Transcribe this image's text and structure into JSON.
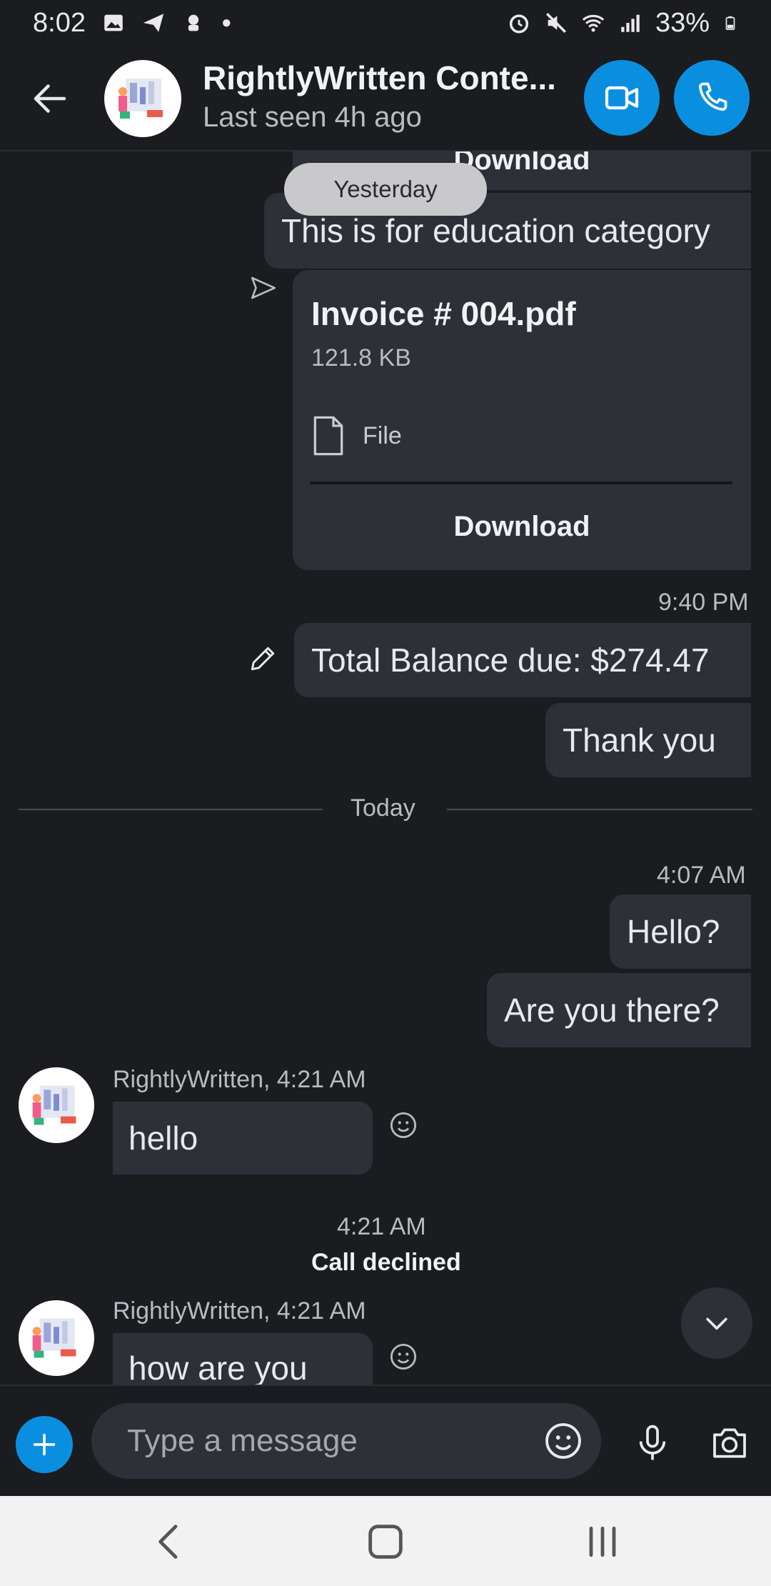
{
  "status_bar": {
    "time": "8:02",
    "battery": "33%"
  },
  "header": {
    "back_icon": "arrow-left-icon",
    "contact_name": "RightlyWritten Conte...",
    "last_seen": "Last seen 4h ago",
    "video_icon": "video-camera-icon",
    "phone_icon": "phone-icon",
    "accent": "#0a8fe0"
  },
  "chat": {
    "date_pill": "Yesterday",
    "partial_top_text": "Download",
    "msg_education": "This is for education category",
    "file": {
      "name": "Invoice # 004.pdf",
      "size": "121.8 KB",
      "type_label": "File",
      "download_label": "Download"
    },
    "time_940": "9:40 PM",
    "msg_balance": "Total Balance due: $274.47",
    "msg_thanks": "Thank you",
    "today_label": "Today",
    "time_407": "4:07 AM",
    "msg_hello_q": "Hello?",
    "msg_there": "Are you there?",
    "incoming_1": {
      "meta": "RightlyWritten, 4:21 AM",
      "text": "hello"
    },
    "call_time": "4:21 AM",
    "call_status": "Call declined",
    "incoming_2": {
      "meta": "RightlyWritten, 4:21 AM",
      "text": "how are you"
    }
  },
  "composer": {
    "placeholder": "Type a message",
    "plus_icon": "plus-icon",
    "emoji_icon": "emoji-icon",
    "mic_icon": "microphone-icon",
    "camera_icon": "camera-icon"
  },
  "nav_bar": {
    "back_icon": "nav-back-icon",
    "home_icon": "nav-home-icon",
    "recents_icon": "nav-recents-icon"
  }
}
